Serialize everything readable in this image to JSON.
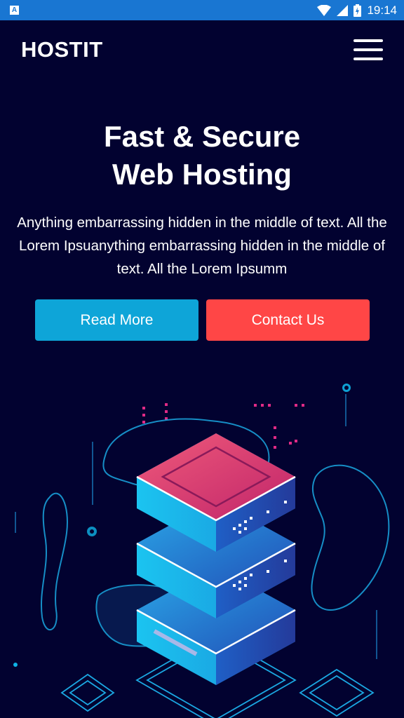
{
  "status_bar": {
    "app_icon_label": "A",
    "time": "19:14",
    "icons": [
      "wifi-icon",
      "signal-icon",
      "battery-icon"
    ],
    "color": "#1976d2"
  },
  "header": {
    "brand": "HOSTIT",
    "menu_icon": "hamburger-menu-icon"
  },
  "hero": {
    "title_line1": "Fast & Secure",
    "title_line2": "Web Hosting",
    "description": "Anything embarrassing hidden in the middle of text. All the Lorem Ipsuanything embarrassing hidden in the middle of text. All the Lorem Ipsumm",
    "read_more_label": "Read More",
    "contact_label": "Contact Us"
  },
  "colors": {
    "background": "#020230",
    "read_more": "#0ea5d8",
    "contact": "#ff4646",
    "server_top": "#e84870"
  }
}
